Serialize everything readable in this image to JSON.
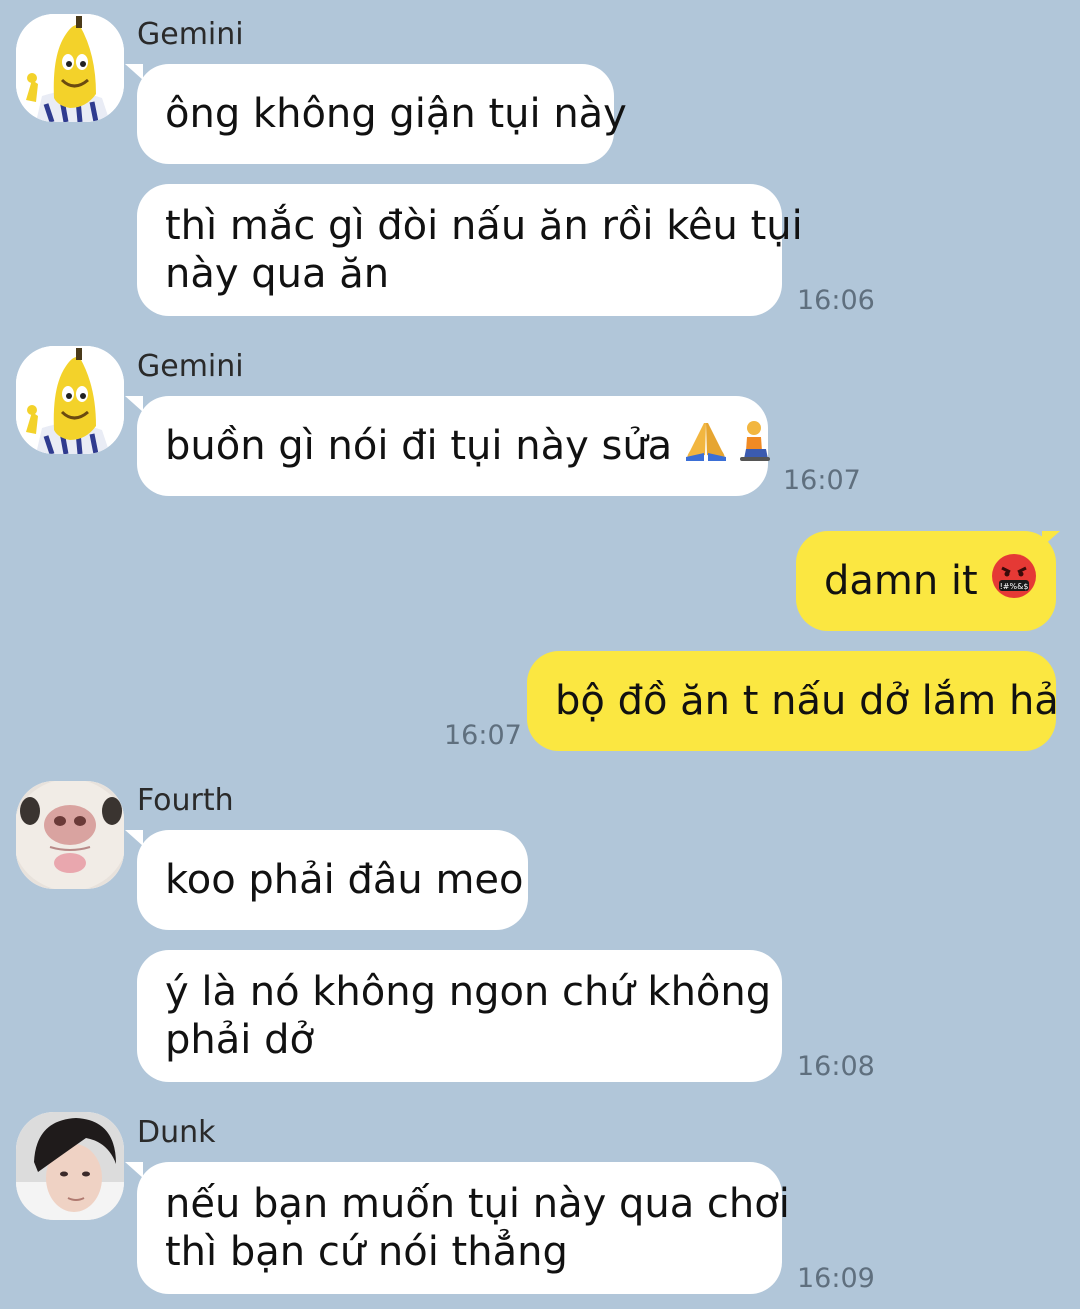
{
  "messages": [
    {
      "sender": "Gemini",
      "bubbles": [
        {
          "lines": [
            "ông không giận tụi này"
          ]
        },
        {
          "lines": [
            "thì mắc gì đòi nấu ăn rồi kêu tụi",
            "này qua ăn"
          ]
        }
      ],
      "time": "16:06"
    },
    {
      "sender": "Gemini",
      "bubbles": [
        {
          "lines": [
            "buồn gì nói đi tụi này sửa"
          ],
          "emoji": [
            "folded-hands",
            "person-kneeling"
          ]
        }
      ],
      "time": "16:07"
    },
    {
      "sender": "me",
      "bubbles": [
        {
          "lines": [
            "damn it"
          ],
          "emoji": [
            "face-with-symbols-on-mouth"
          ]
        },
        {
          "lines": [
            "bộ đồ ăn t nấu dở lắm hả"
          ]
        }
      ],
      "time": "16:07"
    },
    {
      "sender": "Fourth",
      "bubbles": [
        {
          "lines": [
            "koo phải đâu meo"
          ]
        },
        {
          "lines": [
            "ý là nó không ngon chứ không",
            "phải dở"
          ]
        }
      ],
      "time": "16:08"
    },
    {
      "sender": "Dunk",
      "bubbles": [
        {
          "lines": [
            "nếu bạn muốn tụi này qua chơi",
            "thì bạn cứ nói thẳng"
          ]
        }
      ],
      "time": "16:09"
    }
  ],
  "colors": {
    "background": "#b1c6d9",
    "incoming_bubble": "#ffffff",
    "outgoing_bubble": "#fbe741",
    "timestamp": "#5f6f7e"
  },
  "icons": {
    "gemini_avatar": "banana-character-avatar",
    "fourth_avatar": "cat-closeup-avatar",
    "dunk_avatar": "person-photo-avatar"
  }
}
